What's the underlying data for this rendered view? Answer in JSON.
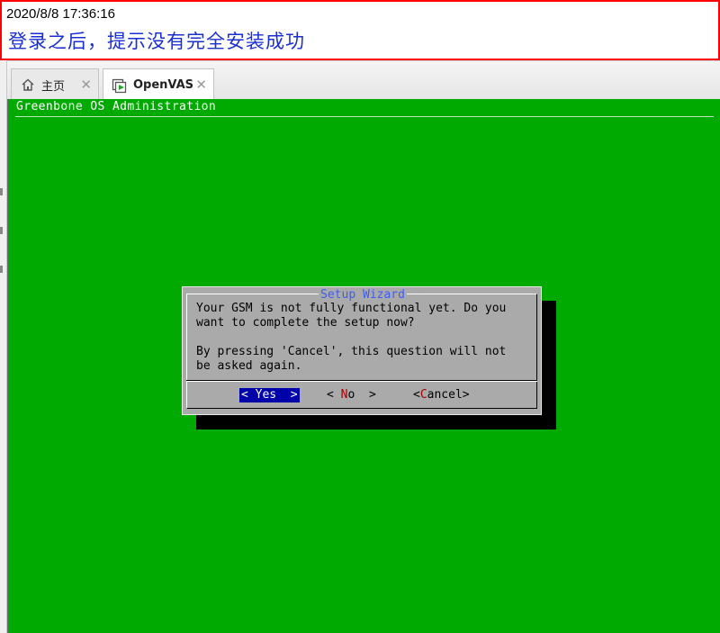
{
  "note": {
    "timestamp": "2020/8/8 17:36:16",
    "message": "登录之后，提示没有完全安装成功"
  },
  "tabs": [
    {
      "label": "主页",
      "icon": "home-icon",
      "active": false
    },
    {
      "label": "OpenVAS",
      "icon": "vm-play-icon",
      "active": true
    }
  ],
  "console": {
    "title": "Greenbone OS Administration",
    "background": "#00aa00"
  },
  "dialog": {
    "title": "Setup Wizard",
    "body_line1": "Your GSM is not fully functional yet. Do you",
    "body_line2": "want to complete the setup now?",
    "body_line3": "",
    "body_line4": "By pressing 'Cancel', this question will not",
    "body_line5": "be asked again.",
    "buttons": {
      "yes_prefix": "<",
      "yes_hot": "Y",
      "yes_rest": "es",
      "yes_suffix": ">",
      "no_prefix": "<",
      "no_hot": "N",
      "no_rest": "o",
      "no_suffix": ">",
      "cancel_prefix": "<",
      "cancel_hot": "C",
      "cancel_rest": "ancel",
      "cancel_suffix": ">"
    },
    "selected_button": "Yes",
    "colors": {
      "selected_bg": "#0000aa",
      "hotkey": "#aa0000",
      "title": "#3c5cf5"
    }
  }
}
